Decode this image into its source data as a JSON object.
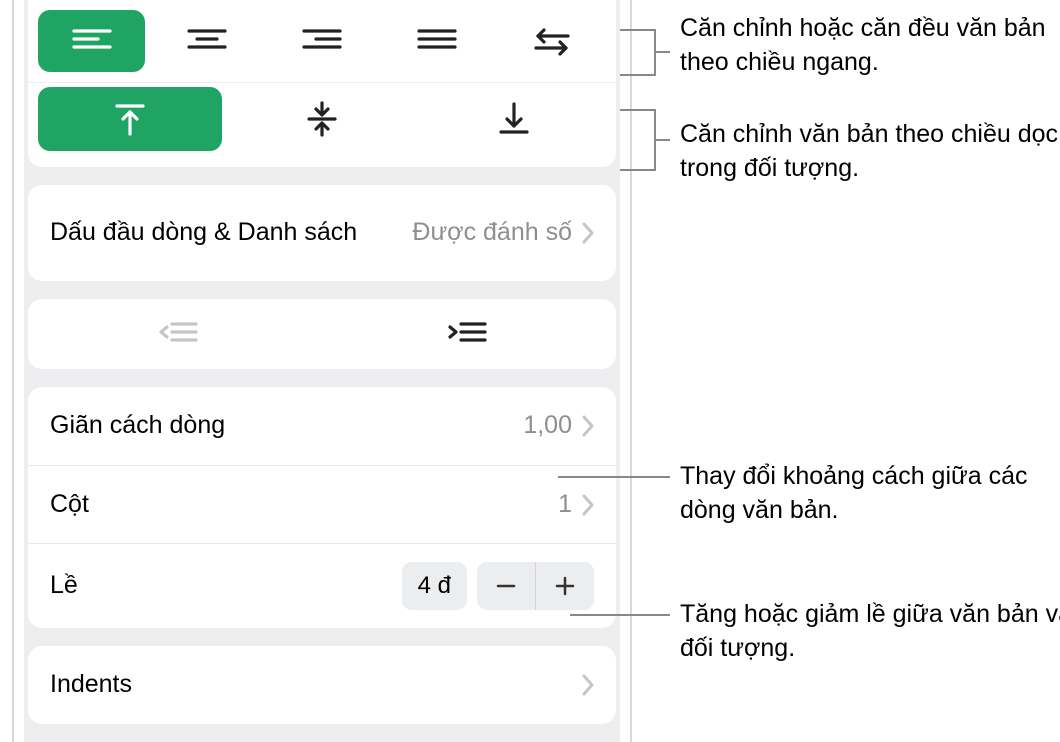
{
  "callouts": {
    "hAlign": "Căn chỉnh hoặc căn đều văn bản theo chiều ngang.",
    "vAlign": "Căn chỉnh văn bản theo chiều dọc trong đối tượng.",
    "lineSpacing": "Thay đổi khoảng cách giữa các dòng văn bản.",
    "margin": "Tăng hoặc giảm lề giữa văn bản và đối tượng."
  },
  "panel": {
    "bullets": {
      "label": "Dấu đầu dòng & Danh sách",
      "value": "Được đánh số"
    },
    "lineSpacing": {
      "label": "Giãn cách dòng",
      "value": "1,00"
    },
    "columns": {
      "label": "Cột",
      "value": "1"
    },
    "margin": {
      "label": "Lề",
      "value": "4 đ"
    },
    "indents": {
      "label": "Indents"
    }
  }
}
